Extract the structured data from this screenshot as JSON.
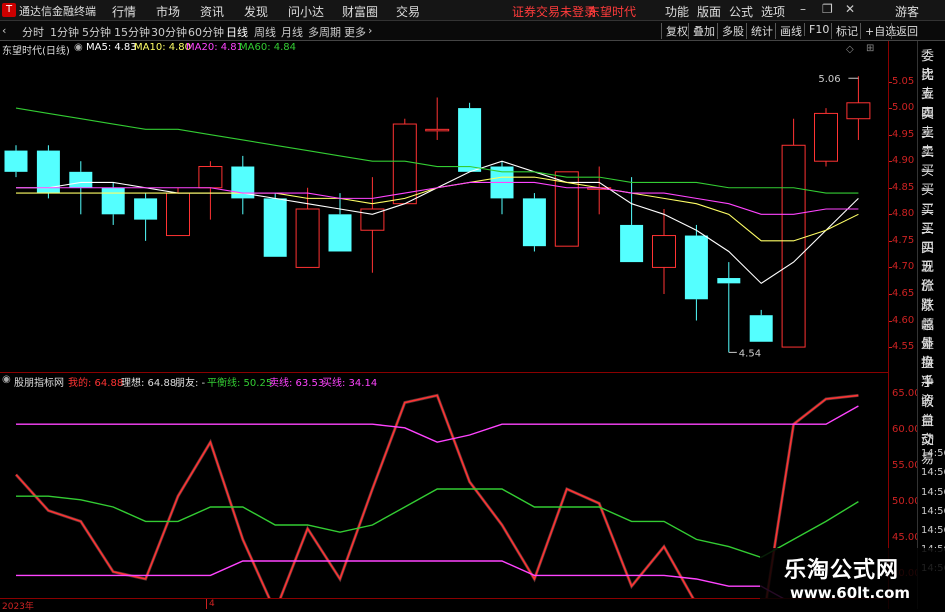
{
  "window": {
    "app_title": "通达信金融终端",
    "menus": [
      "行情",
      "市场",
      "资讯",
      "发现",
      "问小达",
      "财富圈",
      "交易"
    ],
    "notice": "证券交易未登录",
    "stock_name_top": "东望时代",
    "right_menus": [
      "功能",
      "版面",
      "公式",
      "选项"
    ],
    "guest": "游客"
  },
  "toolbar": {
    "periods": [
      "分时",
      "1分钟",
      "5分钟",
      "15分钟",
      "30分钟",
      "60分钟",
      "日线",
      "周线",
      "月线",
      "多周期",
      "更多"
    ],
    "active_period": "日线",
    "right_buttons": [
      "复权",
      "叠加",
      "多股",
      "统计",
      "画线",
      "F10",
      "标记",
      "+自选",
      "返回"
    ]
  },
  "main_info": {
    "title": "东望时代(日线)",
    "ma5": "MA5: 4.83",
    "ma10": "MA10: 4.80",
    "ma20": "MA20: 4.81",
    "ma60": "MA60: 4.84",
    "high_label": "5.06",
    "low_label": "4.54"
  },
  "sub_info": {
    "title": "股朋指标网",
    "wo": "我的: 64.88",
    "lixiang": "理想: 64.88",
    "pengyou": "朋友: -",
    "pingheng": "平衡线: 50.25",
    "maixian": "卖线: 63.53",
    "mai2": "买线: 34.14"
  },
  "colors": {
    "up": "#ff3333",
    "down": "#54ffff",
    "ma5": "#ffffff",
    "ma10": "#ffff66",
    "ma20": "#ff44ff",
    "ma60": "#33cc33",
    "axis": "#cc2222"
  },
  "right_panel": [
    "委比",
    "卖五",
    "卖四",
    "卖三",
    "卖二",
    "卖一",
    "买一",
    "买二",
    "买三",
    "买四",
    "买五",
    "现价",
    "涨跌",
    "涨幅",
    "总量",
    "外盘",
    "换手",
    "净资",
    "收益",
    "自动",
    "交易",
    "14:56",
    "14:56",
    "14:56",
    "14:56",
    "14:56",
    "14:56",
    "14:56"
  ],
  "dates": {
    "year": "2023年",
    "month": "4"
  },
  "watermark": {
    "title": "乐淘公式网",
    "url": "www.60lt.com"
  },
  "chart_data": [
    {
      "type": "candlestick",
      "title": "东望时代(日线)",
      "ylim": [
        4.52,
        5.1
      ],
      "yticks": [
        4.55,
        4.6,
        4.65,
        4.7,
        4.75,
        4.8,
        4.85,
        4.9,
        4.95,
        5.0,
        5.05
      ],
      "candles": [
        {
          "o": 4.92,
          "h": 4.93,
          "l": 4.87,
          "c": 4.88
        },
        {
          "o": 4.92,
          "h": 4.93,
          "l": 4.83,
          "c": 4.84
        },
        {
          "o": 4.88,
          "h": 4.9,
          "l": 4.8,
          "c": 4.85
        },
        {
          "o": 4.85,
          "h": 4.86,
          "l": 4.78,
          "c": 4.8
        },
        {
          "o": 4.83,
          "h": 4.84,
          "l": 4.75,
          "c": 4.79
        },
        {
          "o": 4.76,
          "h": 4.85,
          "l": 4.76,
          "c": 4.84
        },
        {
          "o": 4.85,
          "h": 4.9,
          "l": 4.79,
          "c": 4.89
        },
        {
          "o": 4.89,
          "h": 4.91,
          "l": 4.8,
          "c": 4.83
        },
        {
          "o": 4.83,
          "h": 4.84,
          "l": 4.72,
          "c": 4.72
        },
        {
          "o": 4.7,
          "h": 4.85,
          "l": 4.7,
          "c": 4.81
        },
        {
          "o": 4.8,
          "h": 4.84,
          "l": 4.73,
          "c": 4.73
        },
        {
          "o": 4.77,
          "h": 4.87,
          "l": 4.69,
          "c": 4.81
        },
        {
          "o": 4.82,
          "h": 4.98,
          "l": 4.82,
          "c": 4.97
        },
        {
          "o": 4.96,
          "h": 5.02,
          "l": 4.94,
          "c": 4.96
        },
        {
          "o": 5.0,
          "h": 5.01,
          "l": 4.88,
          "c": 4.88
        },
        {
          "o": 4.89,
          "h": 4.9,
          "l": 4.8,
          "c": 4.83
        },
        {
          "o": 4.83,
          "h": 4.84,
          "l": 4.73,
          "c": 4.74
        },
        {
          "o": 4.74,
          "h": 4.88,
          "l": 4.74,
          "c": 4.88
        },
        {
          "o": 4.85,
          "h": 4.89,
          "l": 4.8,
          "c": 4.85
        },
        {
          "o": 4.78,
          "h": 4.87,
          "l": 4.71,
          "c": 4.71
        },
        {
          "o": 4.7,
          "h": 4.81,
          "l": 4.65,
          "c": 4.76
        },
        {
          "o": 4.76,
          "h": 4.78,
          "l": 4.6,
          "c": 4.64
        },
        {
          "o": 4.68,
          "h": 4.71,
          "l": 4.54,
          "c": 4.67
        },
        {
          "o": 4.61,
          "h": 4.62,
          "l": 4.56,
          "c": 4.56
        },
        {
          "o": 4.55,
          "h": 4.98,
          "l": 4.55,
          "c": 4.93
        },
        {
          "o": 4.9,
          "h": 5.0,
          "l": 4.89,
          "c": 4.99
        },
        {
          "o": 4.98,
          "h": 5.06,
          "l": 4.94,
          "c": 5.01
        }
      ],
      "series": [
        {
          "name": "MA5",
          "values": [
            4.85,
            4.85,
            4.86,
            4.86,
            4.85,
            4.84,
            4.84,
            4.84,
            4.83,
            4.82,
            4.81,
            4.8,
            4.82,
            4.85,
            4.88,
            4.9,
            4.88,
            4.86,
            4.86,
            4.82,
            4.8,
            4.77,
            4.73,
            4.67,
            4.71,
            4.77,
            4.83
          ]
        },
        {
          "name": "MA10",
          "values": [
            4.84,
            4.84,
            4.84,
            4.84,
            4.84,
            4.84,
            4.84,
            4.84,
            4.84,
            4.83,
            4.83,
            4.82,
            4.83,
            4.85,
            4.86,
            4.87,
            4.87,
            4.86,
            4.85,
            4.84,
            4.83,
            4.82,
            4.8,
            4.75,
            4.75,
            4.77,
            4.8
          ]
        },
        {
          "name": "MA20",
          "values": [
            4.85,
            4.85,
            4.85,
            4.85,
            4.85,
            4.85,
            4.85,
            4.84,
            4.84,
            4.84,
            4.83,
            4.83,
            4.84,
            4.85,
            4.86,
            4.86,
            4.86,
            4.85,
            4.85,
            4.84,
            4.84,
            4.83,
            4.82,
            4.8,
            4.8,
            4.81,
            4.81
          ]
        },
        {
          "name": "MA60",
          "values": [
            5.0,
            4.99,
            4.98,
            4.97,
            4.96,
            4.96,
            4.95,
            4.94,
            4.93,
            4.92,
            4.91,
            4.9,
            4.9,
            4.89,
            4.89,
            4.88,
            4.88,
            4.87,
            4.87,
            4.86,
            4.86,
            4.86,
            4.85,
            4.85,
            4.85,
            4.84,
            4.84
          ]
        }
      ]
    },
    {
      "type": "line",
      "title": "股朋指标网",
      "ylim": [
        37,
        67
      ],
      "yticks": [
        40,
        45,
        50,
        55,
        60,
        65
      ],
      "series": [
        {
          "name": "我的",
          "values": [
            54,
            49,
            47.5,
            40.5,
            39.5,
            51,
            58.5,
            45,
            35,
            46.5,
            39.5,
            52,
            64,
            65,
            53,
            47,
            39.5,
            52,
            50,
            38.5,
            44,
            36,
            31,
            32,
            61,
            64.5,
            65
          ]
        },
        {
          "name": "平衡线",
          "values": [
            51,
            51,
            50.5,
            49.5,
            47.5,
            47.5,
            49.5,
            49.5,
            47,
            47,
            46,
            47,
            49.5,
            52,
            52,
            52,
            49.5,
            49.5,
            49.5,
            47.5,
            47.5,
            45,
            44,
            42.5,
            45,
            47.5,
            50.25
          ]
        },
        {
          "name": "卖线",
          "values": [
            61,
            61,
            61,
            61,
            61,
            61,
            61,
            61,
            61,
            61,
            61,
            61,
            60.5,
            58.5,
            59.5,
            61,
            61,
            61,
            61,
            61,
            61,
            61,
            61,
            61,
            61,
            61,
            63.53
          ]
        },
        {
          "name": "买线",
          "values": [
            40,
            40,
            40,
            40,
            40,
            40,
            40,
            42,
            42,
            42,
            42,
            42,
            42,
            42,
            42,
            42,
            40,
            40,
            40,
            40,
            40,
            39.5,
            38.5,
            38.5,
            36,
            35,
            34.14
          ]
        }
      ]
    }
  ]
}
